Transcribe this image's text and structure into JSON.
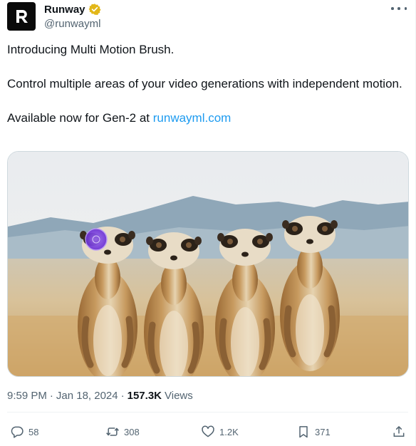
{
  "author": {
    "name": "Runway",
    "handle": "@runwayml",
    "verified_color": "#e2b719"
  },
  "tweet": {
    "line1": "Introducing Multi Motion Brush.",
    "line2": "Control multiple areas of your video generations with independent motion.",
    "line3_prefix": "Available now for Gen-2 at ",
    "line3_link": "runwayml.com"
  },
  "media": {
    "icon_name": "motion-brush-cursor-icon",
    "brush_color": "#7b3fe4"
  },
  "meta": {
    "time": "9:59 PM",
    "separator": "·",
    "date": "Jan 18, 2024",
    "views_count": "157.3K",
    "views_label": "Views"
  },
  "actions": {
    "replies": "58",
    "reposts": "308",
    "likes": "1.2K",
    "bookmarks": "371"
  },
  "colors": {
    "text": "#0f1419",
    "secondary": "#536471",
    "link": "#1d9bf0"
  }
}
